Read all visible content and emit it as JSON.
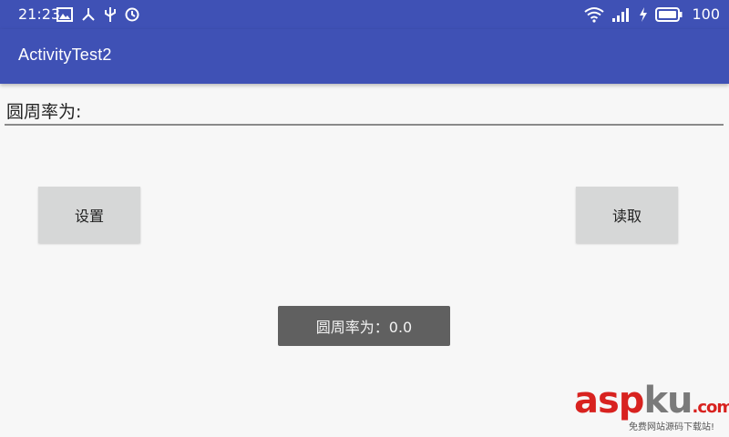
{
  "status_bar": {
    "time": "21:23",
    "battery_level": "100",
    "icons_left": [
      "image-icon",
      "usb-tether-icon",
      "usb-icon",
      "alarm-icon"
    ],
    "icons_right": [
      "wifi-icon",
      "signal-icon",
      "charging-icon",
      "battery-icon"
    ]
  },
  "app_bar": {
    "title": "ActivityTest2",
    "color": "#3f51b5"
  },
  "main": {
    "pi_label": "圆周率为:",
    "set_button_label": "设置",
    "read_button_label": "读取"
  },
  "toast": {
    "text": "圆周率为：0.0"
  },
  "watermark": {
    "brand_main": "asp",
    "brand_accent": "ku",
    "brand_suffix": ".com",
    "tagline": "免费网站源码下载站!"
  }
}
